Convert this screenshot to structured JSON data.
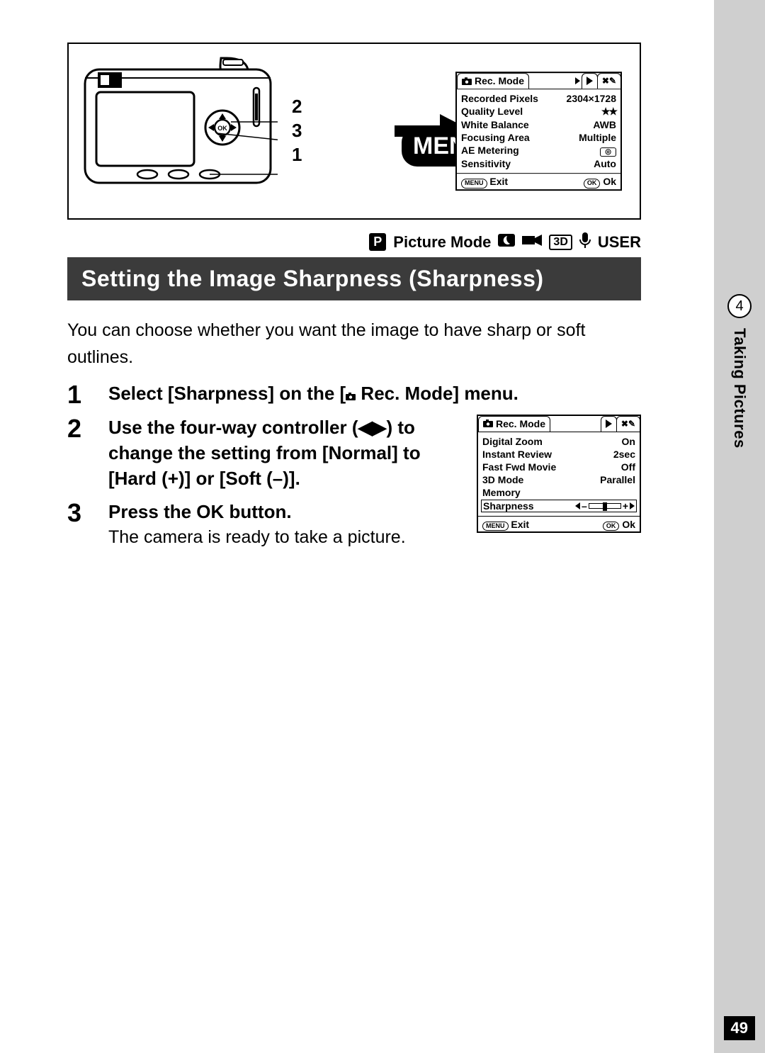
{
  "side": {
    "chapter_num": "4",
    "chapter_label": "Taking Pictures"
  },
  "page_number": "49",
  "callouts": [
    "2",
    "3",
    "1"
  ],
  "menu_badge": "MENU",
  "mode_bar": {
    "p": "P",
    "label": "Picture Mode",
    "user": "USER",
    "threeD": "3D"
  },
  "heading": "Setting the Image Sharpness (Sharpness)",
  "intro": "You can choose whether you want the image to have sharp or soft outlines.",
  "steps": {
    "s1": {
      "num": "1",
      "title_a": "Select [Sharpness] on the [",
      "title_b": " Rec. Mode] menu."
    },
    "s2": {
      "num": "2",
      "title": "Use the four-way controller (◀▶) to change the setting from [Normal] to [Hard (+)] or [Soft (–)]."
    },
    "s3": {
      "num": "3",
      "title": "Press the OK button.",
      "text": "The camera is ready to take a picture."
    }
  },
  "screen1": {
    "tab_active": "Rec. Mode",
    "rows": [
      {
        "k": "Recorded Pixels",
        "v": "2304×1728"
      },
      {
        "k": "Quality Level",
        "v": "★★"
      },
      {
        "k": "White Balance",
        "v": "AWB"
      },
      {
        "k": "Focusing Area",
        "v": "Multiple"
      },
      {
        "k": "AE Metering",
        "v": "__AE__"
      },
      {
        "k": "Sensitivity",
        "v": "Auto"
      }
    ],
    "foot_menu": "MENU",
    "foot_exit": "Exit",
    "foot_ok_pill": "OK",
    "foot_ok": "Ok"
  },
  "screen2": {
    "tab_active": "Rec. Mode",
    "rows": [
      {
        "k": "Digital Zoom",
        "v": "On"
      },
      {
        "k": "Instant Review",
        "v": "2sec"
      },
      {
        "k": "Fast Fwd Movie",
        "v": "Off"
      },
      {
        "k": "3D Mode",
        "v": "Parallel"
      },
      {
        "k": "Memory",
        "v": ""
      }
    ],
    "sel_label": "Sharpness",
    "slider_left": "–",
    "slider_right": "+",
    "foot_menu": "MENU",
    "foot_exit": "Exit",
    "foot_ok_pill": "OK",
    "foot_ok": "Ok"
  }
}
